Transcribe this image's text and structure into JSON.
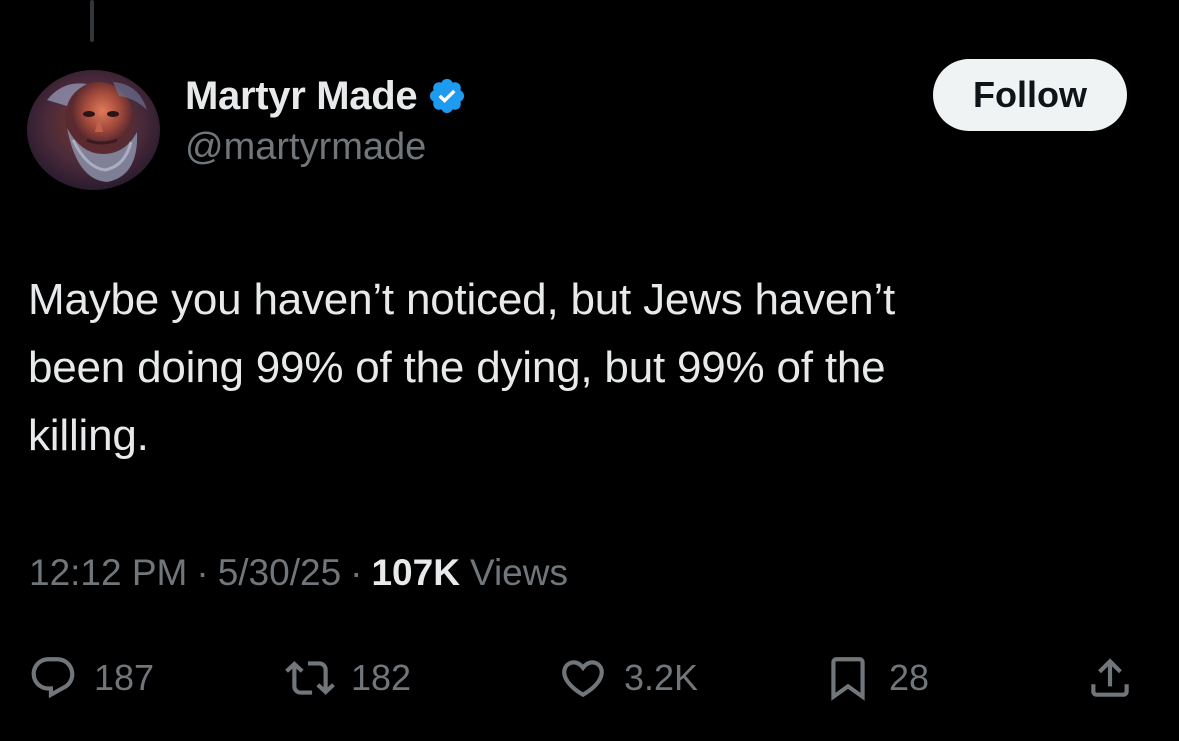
{
  "author": {
    "display_name": "Martyr Made",
    "handle": "@martyrmade",
    "verified": true
  },
  "follow_button": {
    "label": "Follow"
  },
  "tweet": {
    "lines": [
      "Maybe you haven’t noticed, but Jews haven’t",
      "been doing 99% of the dying, but 99% of the",
      "killing."
    ]
  },
  "meta": {
    "time": "12:12 PM",
    "separator": "·",
    "date": "5/30/25",
    "views_count": "107K",
    "views_label": "Views"
  },
  "actions": {
    "replies": {
      "icon": "reply-icon",
      "count": "187"
    },
    "reposts": {
      "icon": "repost-icon",
      "count": "182"
    },
    "likes": {
      "icon": "heart-icon",
      "count": "3.2K"
    },
    "bookmarks": {
      "icon": "bookmark-icon",
      "count": "28"
    },
    "share": {
      "icon": "share-icon"
    }
  },
  "colors": {
    "background": "#000000",
    "primary_text": "#e7e9ea",
    "secondary_text": "#71767b",
    "verified_badge": "#1d9bf0",
    "follow_button_bg": "#eff3f4",
    "follow_button_text": "#0f1419"
  }
}
